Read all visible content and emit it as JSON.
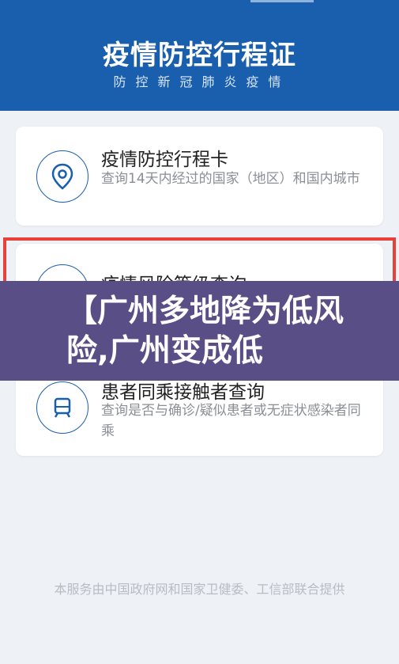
{
  "header": {
    "title": "疫情防控行程证",
    "subtitle": "防控新冠肺炎疫情"
  },
  "cards": [
    {
      "title": "疫情防控行程卡",
      "description": "查询14天内经过的国家（地区）和国内城市",
      "icon": "location-pin-icon"
    },
    {
      "title": "疫情风险等级查询",
      "icon": "person-icon"
    },
    {
      "title": "患者同乘接触者查询",
      "description": "查询是否与确诊/疑似患者或无症状感染者同乘",
      "icon": "train-icon"
    }
  ],
  "overlay": {
    "headline": "【广州多地降为低风险,广州变成低"
  },
  "footer": {
    "text": "本服务由中国政府网和国家卫健委、工信部联合提供"
  },
  "colors": {
    "header_bg": "#1a5fae",
    "highlight_border": "#e8403a",
    "overlay_bg": "#5a4e86"
  }
}
